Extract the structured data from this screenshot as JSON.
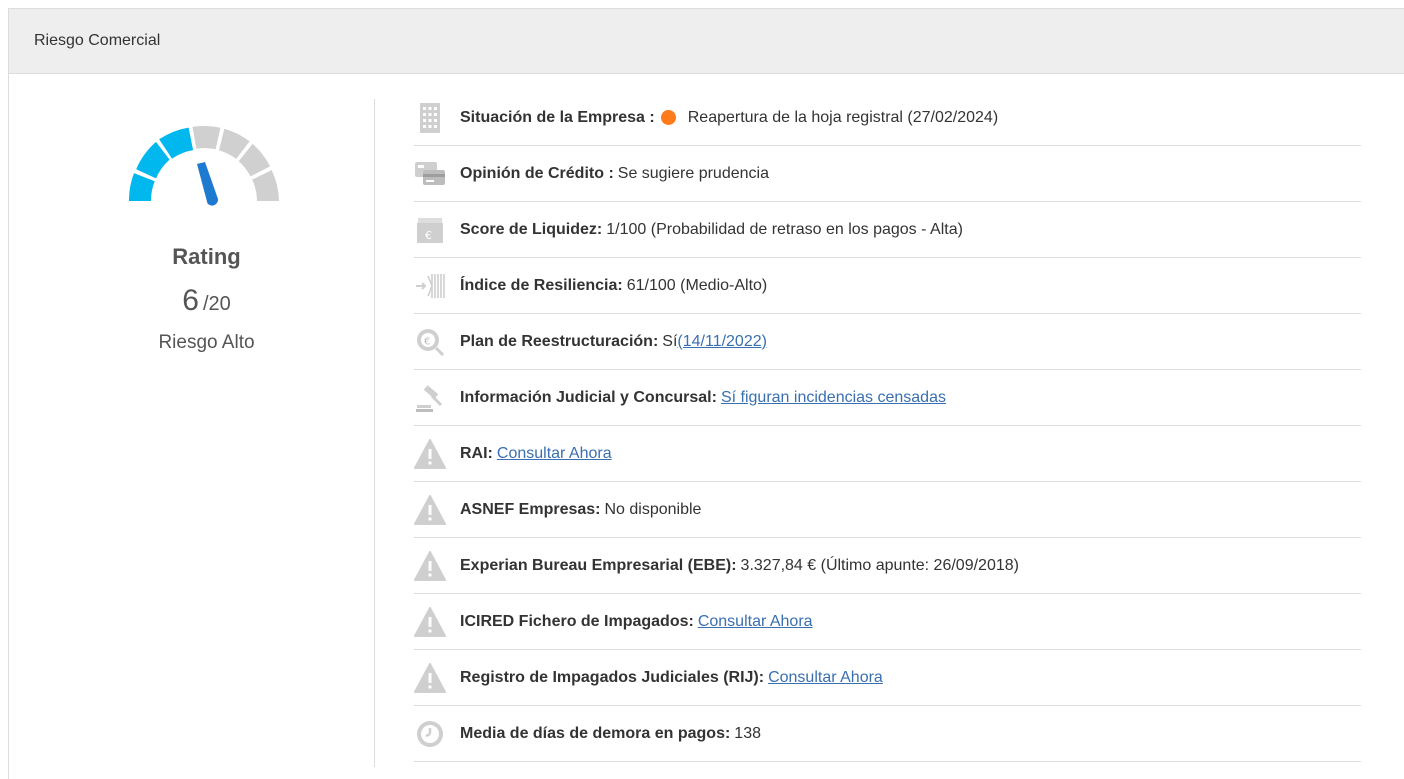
{
  "header": {
    "title": "Riesgo Comercial"
  },
  "rating": {
    "label": "Rating",
    "score": "6",
    "max": "/20",
    "risk_text": "Riesgo Alto",
    "gauge_level": 0.3,
    "colors": {
      "active": "#00b8ee",
      "inactive": "#d0d0d0",
      "needle": "#1e7ad1"
    }
  },
  "items": [
    {
      "icon": "building-icon",
      "label": "Situación de la Empresa :",
      "status_color": "#ff7a1a",
      "value": "Reapertura de la hoja registral (27/02/2024)"
    },
    {
      "icon": "credit-card-icon",
      "label": "Opinión de Crédito :",
      "value": "Se sugiere prudencia"
    },
    {
      "icon": "wallet-euro-icon",
      "label": "Score de Liquidez:",
      "value": "1/100 (Probabilidad de retraso en los pagos - Alta)"
    },
    {
      "icon": "resilience-icon",
      "label": "Índice de Resiliencia:",
      "value": "61/100 (Medio-Alto)"
    },
    {
      "icon": "euro-search-icon",
      "label": "Plan de Reestructuración:",
      "value": "Sí",
      "link": "(14/11/2022)"
    },
    {
      "icon": "gavel-icon",
      "label": "Información Judicial y Concursal:",
      "link": "Sí figuran incidencias censadas"
    },
    {
      "icon": "warning-icon",
      "label": "RAI:",
      "link": "Consultar Ahora"
    },
    {
      "icon": "warning-icon",
      "label": "ASNEF Empresas:",
      "value": "No disponible"
    },
    {
      "icon": "warning-icon",
      "label": "Experian Bureau Empresarial (EBE):",
      "value": "3.327,84 € (Último apunte: 26/09/2018)"
    },
    {
      "icon": "warning-icon",
      "label": "ICIRED Fichero de Impagados:",
      "link": "Consultar Ahora"
    },
    {
      "icon": "warning-icon",
      "label": "Registro de Impagados Judiciales (RIJ):",
      "link": "Consultar Ahora"
    },
    {
      "icon": "clock-icon",
      "label": "Media de días de demora en pagos:",
      "value": "138"
    }
  ]
}
